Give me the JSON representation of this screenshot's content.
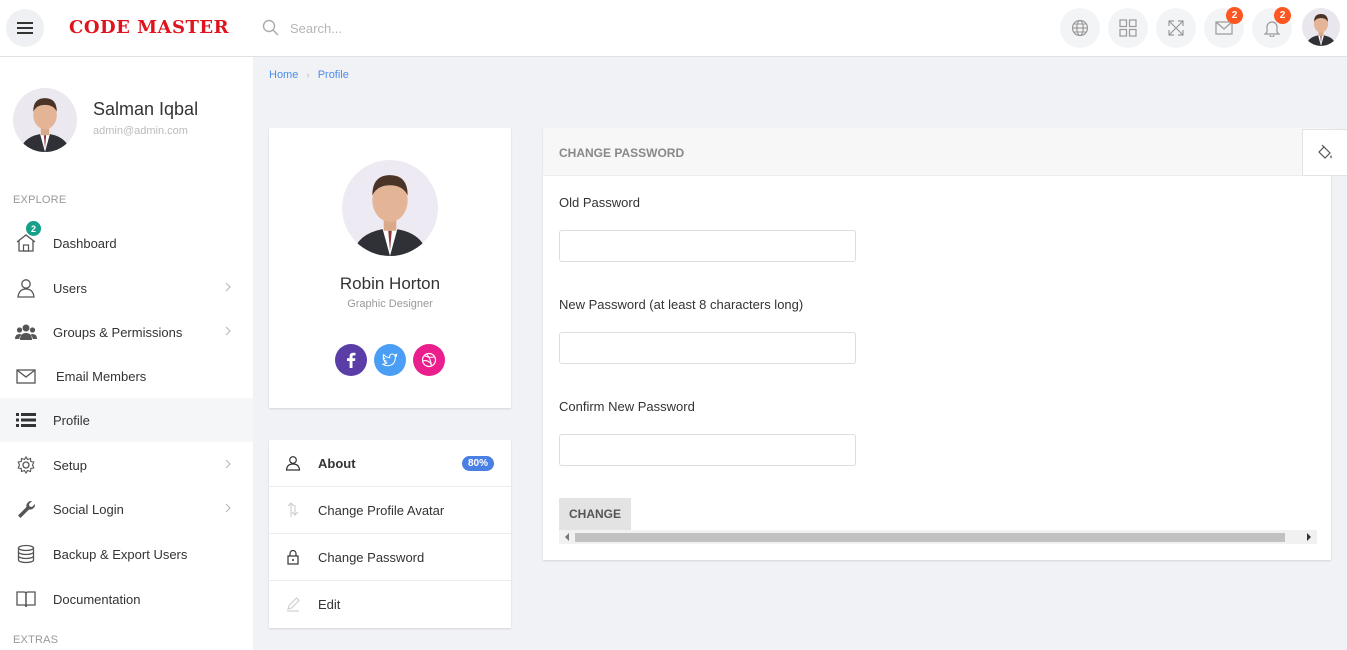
{
  "brand": "CODE MASTER",
  "search": {
    "placeholder": "Search..."
  },
  "topbar": {
    "mail_badge": "2",
    "notif_badge": "2"
  },
  "sidebar": {
    "user_name": "Salman Iqbal",
    "user_email": "admin@admin.com",
    "section_explore": "EXPLORE",
    "section_extras": "EXTRAS",
    "items": [
      {
        "label": "Dashboard",
        "icon": "home-icon",
        "badge": "2"
      },
      {
        "label": "Users",
        "icon": "user-icon"
      },
      {
        "label": "Groups & Permissions",
        "icon": "users-icon"
      },
      {
        "label": "Email Members",
        "icon": "envelope-icon"
      },
      {
        "label": "Profile",
        "icon": "list-icon",
        "active": true
      },
      {
        "label": "Setup",
        "icon": "gear-icon"
      },
      {
        "label": "Social Login",
        "icon": "wrench-icon"
      },
      {
        "label": "Backup & Export Users",
        "icon": "database-icon"
      },
      {
        "label": "Documentation",
        "icon": "book-icon"
      }
    ]
  },
  "breadcrumb": {
    "home": "Home",
    "current": "Profile"
  },
  "profile": {
    "name": "Robin Horton",
    "title": "Graphic Designer",
    "socials": [
      "facebook-icon",
      "twitter-icon",
      "dribbble-icon"
    ]
  },
  "profile_menu": {
    "items": [
      {
        "label": "About",
        "badge": "80%",
        "icon": "user-icon"
      },
      {
        "label": "Change Profile Avatar",
        "icon": "arrows-icon"
      },
      {
        "label": "Change Password",
        "icon": "lock-icon"
      },
      {
        "label": "Edit",
        "icon": "pencil-icon"
      }
    ]
  },
  "change_password": {
    "header": "CHANGE PASSWORD",
    "old_label": "Old Password",
    "old_value": "",
    "new_label": "New Password (at least 8 characters long)",
    "new_value": "",
    "confirm_label": "Confirm New Password",
    "confirm_value": "",
    "button": "CHANGE"
  },
  "colors": {
    "brand_red": "#e0141e",
    "link_blue": "#4a8de9",
    "badge_orange": "#ff5722",
    "badge_teal": "#17a089",
    "facebook": "#5b3da8",
    "twitter": "#4a9ff5",
    "dribbble": "#ea1e8c"
  }
}
